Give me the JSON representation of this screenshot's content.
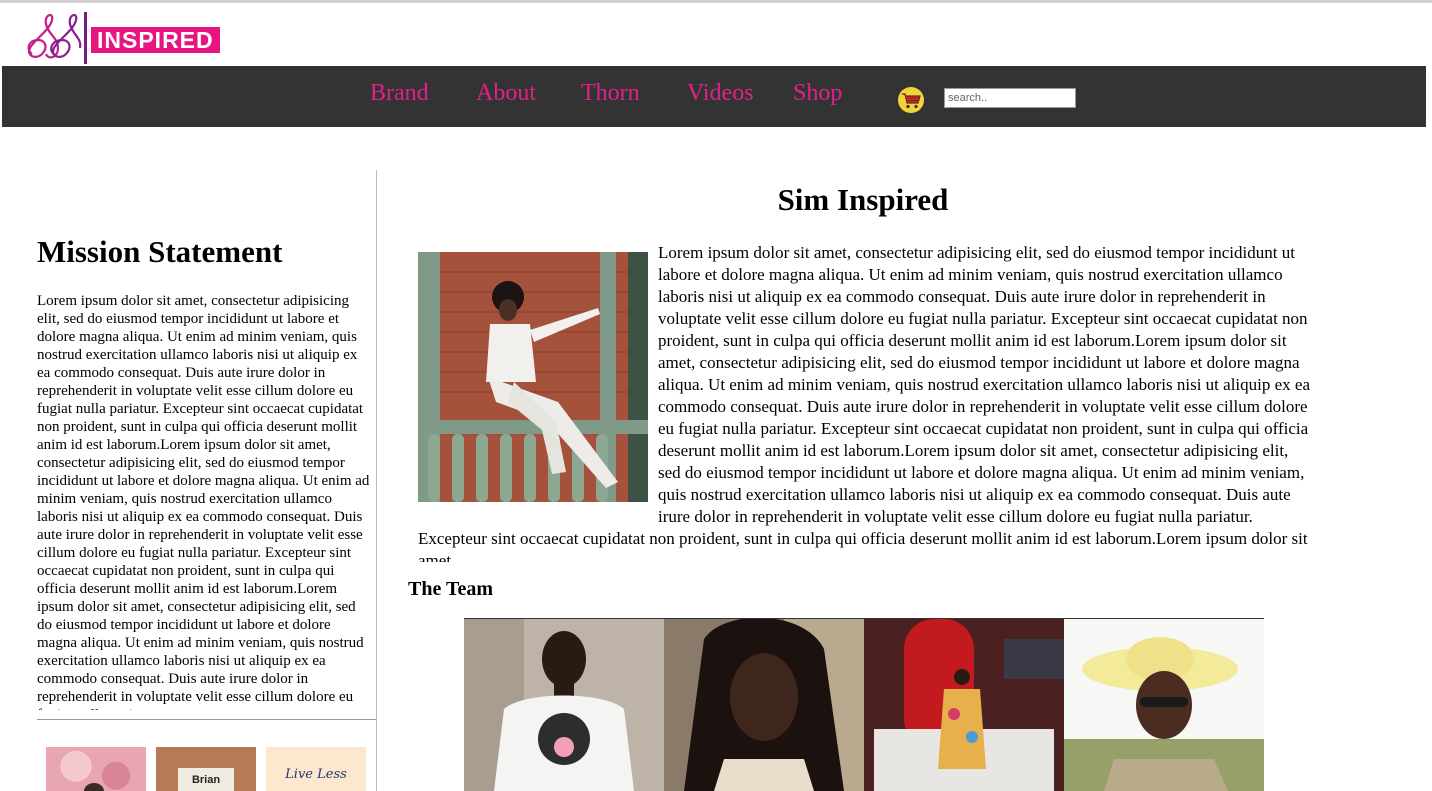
{
  "brand": {
    "logo_letters": "SS",
    "logo_word": "INSPIRED"
  },
  "nav": {
    "links": [
      "Brand",
      "About",
      "Thorn",
      "Videos",
      "Shop"
    ],
    "cart_icon": "shopping-cart-icon",
    "search_placeholder": "search.."
  },
  "sidebar": {
    "title": "Mission Statement",
    "text": "Lorem ipsum dolor sit amet, consectetur adipisicing elit, sed do eiusmod tempor incididunt ut labore et dolore magna aliqua. Ut enim ad minim veniam, quis nostrud exercitation ullamco laboris nisi ut aliquip ex ea commodo consequat. Duis aute irure dolor in reprehenderit in voluptate velit esse cillum dolore eu fugiat nulla pariatur. Excepteur sint occaecat cupidatat non proident, sunt in culpa qui officia deserunt mollit anim id est laborum.Lorem ipsum dolor sit amet, consectetur adipisicing elit, sed do eiusmod tempor incididunt ut labore et dolore magna aliqua. Ut enim ad minim veniam, quis nostrud exercitation ullamco laboris nisi ut aliquip ex ea commodo consequat. Duis aute irure dolor in reprehenderit in voluptate velit esse cillum dolore eu fugiat nulla pariatur. Excepteur sint occaecat cupidatat non proident, sunt in culpa qui officia deserunt mollit anim id est laborum.Lorem ipsum dolor sit amet, consectetur adipisicing elit, sed do eiusmod tempor incididunt ut labore et dolore magna aliqua. Ut enim ad minim veniam, quis nostrud exercitation ullamco laboris nisi ut aliquip ex ea commodo consequat. Duis aute irure dolor in reprehenderit in voluptate velit esse cillum dolore eu fugiat nulla pariatur.",
    "thumbnails": [
      {
        "caption": ""
      },
      {
        "caption": "Brian Tracy"
      },
      {
        "caption": "Live Less"
      }
    ]
  },
  "main": {
    "title": "Sim Inspired",
    "text": "Lorem ipsum dolor sit amet, consectetur adipisicing elit, sed do eiusmod tempor incididunt ut labore et dolore magna aliqua. Ut enim ad minim veniam, quis nostrud exercitation ullamco laboris nisi ut aliquip ex ea commodo consequat. Duis aute irure dolor in reprehenderit in voluptate velit esse cillum dolore eu fugiat nulla pariatur. Excepteur sint occaecat cupidatat non proident, sunt in culpa qui officia deserunt mollit anim id est laborum.Lorem ipsum dolor sit amet, consectetur adipisicing elit, sed do eiusmod tempor incididunt ut labore et dolore magna aliqua. Ut enim ad minim veniam, quis nostrud exercitation ullamco laboris nisi ut aliquip ex ea commodo consequat. Duis aute irure dolor in reprehenderit in voluptate velit esse cillum dolore eu fugiat nulla pariatur. Excepteur sint occaecat cupidatat non proident, sunt in culpa qui officia deserunt mollit anim id est laborum.Lorem ipsum dolor sit amet, consectetur adipisicing elit, sed do eiusmod tempor incididunt ut labore et dolore magna aliqua. Ut enim ad minim veniam, quis nostrud exercitation ullamco laboris nisi ut aliquip ex ea commodo consequat. Duis aute irure dolor in reprehenderit in voluptate velit esse cillum dolore eu fugiat nulla pariatur. Excepteur sint occaecat cupidatat non proident, sunt in culpa qui officia deserunt mollit anim id est laborum.Lorem ipsum dolor sit amet",
    "team_title": "The Team"
  },
  "colors": {
    "nav_bg": "#333333",
    "nav_link": "#e0218a",
    "brand_pink": "#e6157f",
    "brand_purple": "#7a1a84"
  }
}
